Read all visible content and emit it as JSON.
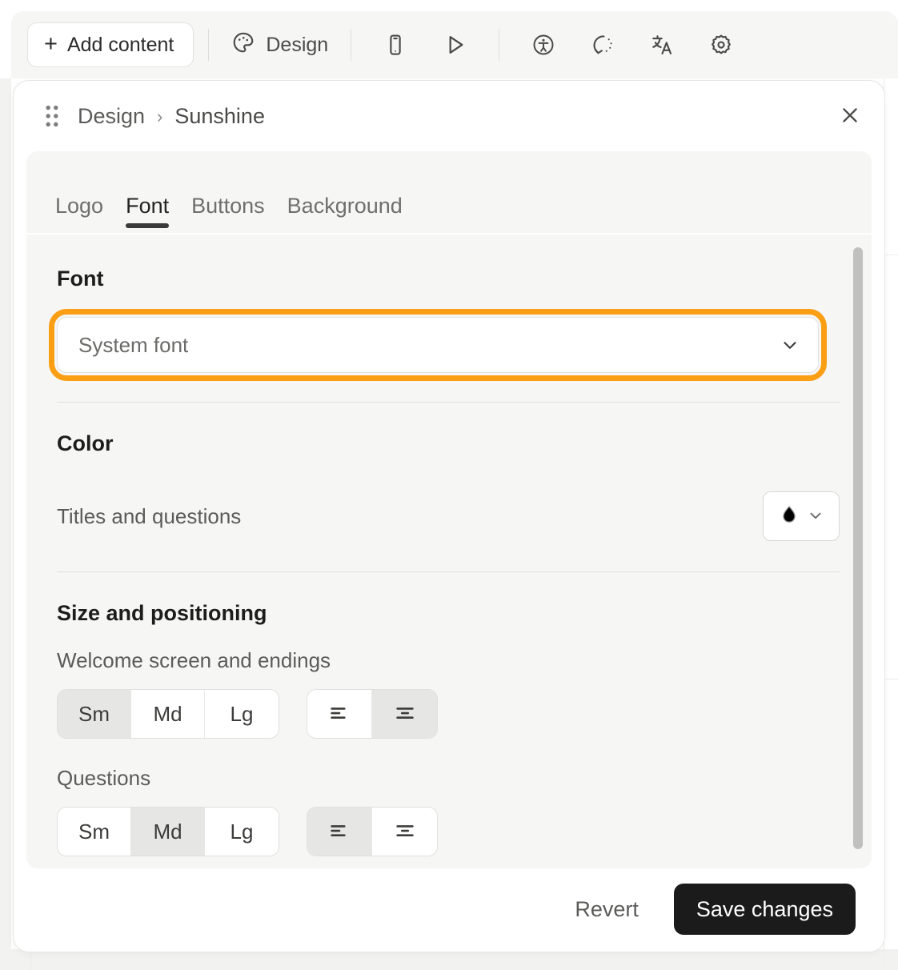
{
  "toolbar": {
    "add_content_label": "Add content",
    "add_content_icon": "plus-icon",
    "design_label": "Design",
    "design_icon": "palette-icon",
    "icons": [
      {
        "name": "mobile-preview-icon",
        "title": "Mobile preview"
      },
      {
        "name": "play-preview-icon",
        "title": "Preview"
      },
      {
        "name": "accessibility-icon",
        "title": "Accessibility"
      },
      {
        "name": "logic-jump-icon",
        "title": "Logic"
      },
      {
        "name": "translate-icon",
        "title": "Translate"
      },
      {
        "name": "settings-gear-icon",
        "title": "Settings"
      }
    ]
  },
  "panel": {
    "drag_handle_icon": "drag-dots-icon",
    "breadcrumb": {
      "root": "Design",
      "separator": "›",
      "current": "Sunshine"
    },
    "close_icon": "close-icon",
    "tabs": [
      {
        "label": "Logo",
        "active": false
      },
      {
        "label": "Font",
        "active": true
      },
      {
        "label": "Buttons",
        "active": false
      },
      {
        "label": "Background",
        "active": false
      }
    ],
    "sections": {
      "font": {
        "title": "Font",
        "select_value": "System font",
        "select_chevron_icon": "chevron-down-icon"
      },
      "color": {
        "title": "Color",
        "row_label": "Titles and questions",
        "swatch_icon": "color-drop-icon",
        "swatch_color": "#000000",
        "swatch_chevron_icon": "chevron-down-icon"
      },
      "size_positioning": {
        "title": "Size and positioning",
        "groups": [
          {
            "label": "Welcome screen and endings",
            "sizes": [
              "Sm",
              "Md",
              "Lg"
            ],
            "selected_size": "Sm",
            "alignments": [
              {
                "name": "align-left-icon",
                "label": "Left"
              },
              {
                "name": "align-center-icon",
                "label": "Center"
              }
            ],
            "selected_alignment": "align-center-icon"
          },
          {
            "label": "Questions",
            "sizes": [
              "Sm",
              "Md",
              "Lg"
            ],
            "selected_size": "Md",
            "alignments": [
              {
                "name": "align-left-icon",
                "label": "Left"
              },
              {
                "name": "align-center-icon",
                "label": "Center"
              }
            ],
            "selected_alignment": "align-left-icon"
          }
        ]
      }
    },
    "footer": {
      "revert_label": "Revert",
      "save_label": "Save changes"
    }
  },
  "colors": {
    "highlight_orange": "#fa9f14",
    "save_button_bg": "#1b1b1b",
    "card_bg": "#f6f6f5",
    "selected_segment_bg": "#e6e6e4",
    "active_tab_underline": "#3a3a3a"
  }
}
